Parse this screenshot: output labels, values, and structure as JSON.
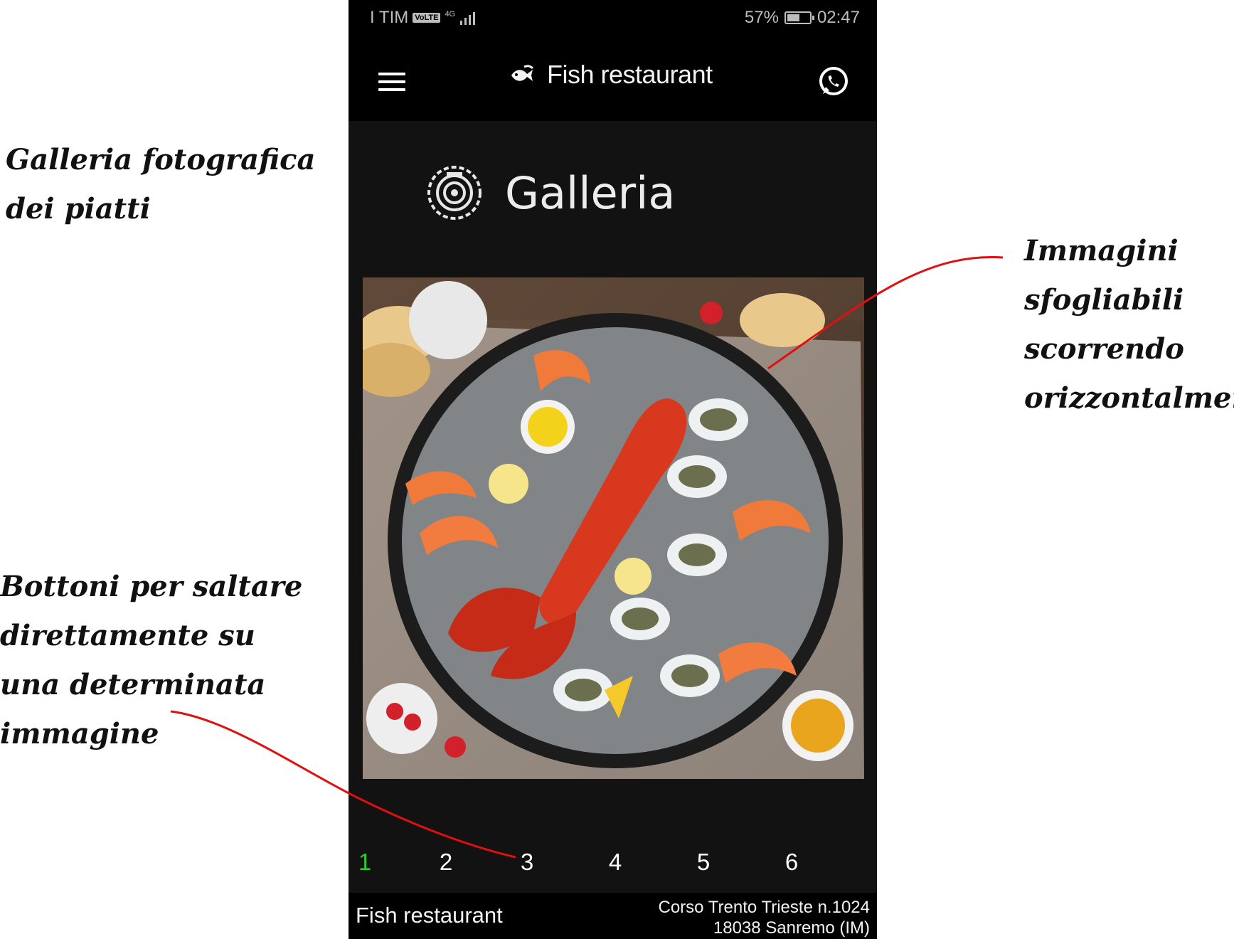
{
  "annotations": {
    "gallery_lines": [
      "Galleria fotografica",
      "dei piatti"
    ],
    "swipe_lines": [
      "Immagini",
      "sfogliabili",
      "scorrendo",
      "orizzontalmente"
    ],
    "buttons_lines": [
      "Bottoni per saltare",
      "direttamente su",
      "una determinata",
      "immagine"
    ],
    "arrow_color": "#e01010"
  },
  "status_bar": {
    "carrier": "I TIM",
    "volte": "VoLTE",
    "network": "4G",
    "battery_percent": "57%",
    "battery_level": 0.57,
    "time": "02:47"
  },
  "header": {
    "menu_icon": "hamburger-menu-icon",
    "logo_icon": "fish-logo-icon",
    "title": "Fish restaurant",
    "contact_icon": "whatsapp-icon"
  },
  "page": {
    "icon": "gallery-camera-icon",
    "title": "Galleria"
  },
  "gallery": {
    "current_image_subject": "seafood platter",
    "pages": [
      "1",
      "2",
      "3",
      "4",
      "5",
      "6"
    ],
    "active_page": "1",
    "active_color": "#2ecc2e"
  },
  "footer": {
    "brand": "Fish restaurant",
    "address_line1": "Corso Trento Trieste n.1024",
    "address_line2": "18038 Sanremo (IM)"
  }
}
